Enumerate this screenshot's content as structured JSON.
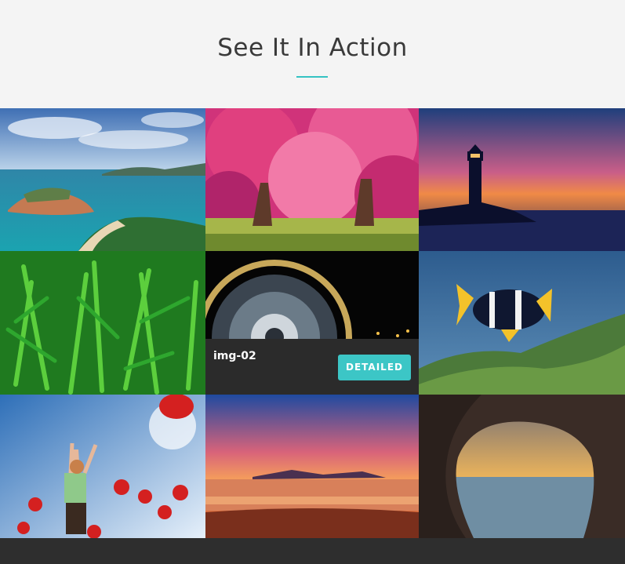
{
  "section": {
    "title": "See It In Action",
    "accent_color": "#34c3c3"
  },
  "gallery": {
    "items": [
      {
        "label": "island coast",
        "content": "coastal-island-photo"
      },
      {
        "label": "pink blossom trees",
        "content": "blossom-trees-photo"
      },
      {
        "label": "lighthouse sunset",
        "content": "lighthouse-sunset-photo"
      },
      {
        "label": "green grass",
        "content": "grass-photo"
      },
      {
        "label": "img-02",
        "content": "ferris-wheel-night-photo",
        "hovered": true
      },
      {
        "label": "clownfish",
        "content": "clownfish-photo"
      },
      {
        "label": "woman in poppies",
        "content": "poppies-photo"
      },
      {
        "label": "beach sunset",
        "content": "beach-sunset-photo"
      },
      {
        "label": "sea cave",
        "content": "sea-cave-photo"
      }
    ],
    "hover_overlay": {
      "title": "img-02",
      "button_label": "DETAILED",
      "button_color": "#3cc6c6"
    }
  }
}
